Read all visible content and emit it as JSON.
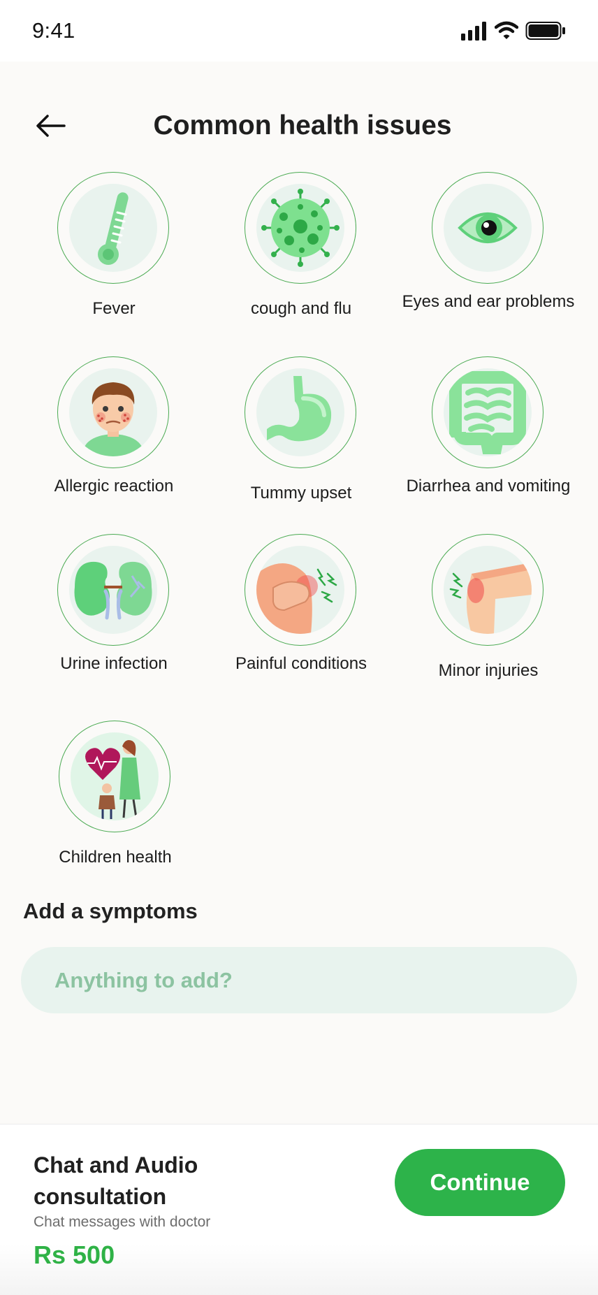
{
  "status_bar": {
    "time": "9:41",
    "icons": [
      "cellular-signal-icon",
      "wifi-icon",
      "battery-icon"
    ]
  },
  "header": {
    "back_icon": "arrow-left-icon",
    "title": "Common health issues"
  },
  "issues": [
    {
      "label": "Fever",
      "icon": "thermometer-icon"
    },
    {
      "label": "cough and flu",
      "icon": "virus-icon"
    },
    {
      "label": "Eyes and ear problems",
      "icon": "eye-icon"
    },
    {
      "label": "Allergic reaction",
      "icon": "allergic-face-icon"
    },
    {
      "label": "Tummy upset",
      "icon": "stomach-icon"
    },
    {
      "label": "Diarrhea and vomiting",
      "icon": "intestine-icon"
    },
    {
      "label": "Urine infection",
      "icon": "kidneys-icon"
    },
    {
      "label": "Painful conditions",
      "icon": "shoulder-pain-icon"
    },
    {
      "label": "Minor injuries",
      "icon": "knee-injury-icon"
    },
    {
      "label": "Children health",
      "icon": "mother-child-heart-icon"
    }
  ],
  "symptoms": {
    "title": "Add a symptoms",
    "placeholder": "Anything to add?",
    "value": ""
  },
  "consultation": {
    "title": "Chat and Audio consultation",
    "subtitle": "Chat messages with doctor",
    "price": "Rs 500",
    "button_label": "Continue"
  },
  "colors": {
    "accent": "#2db34a",
    "ring": "#4aaa52",
    "disc": "#e9f3ee",
    "input_background": "#e8f3ee",
    "placeholder": "#8cc3a1",
    "page_background": "#fbfaf8"
  }
}
